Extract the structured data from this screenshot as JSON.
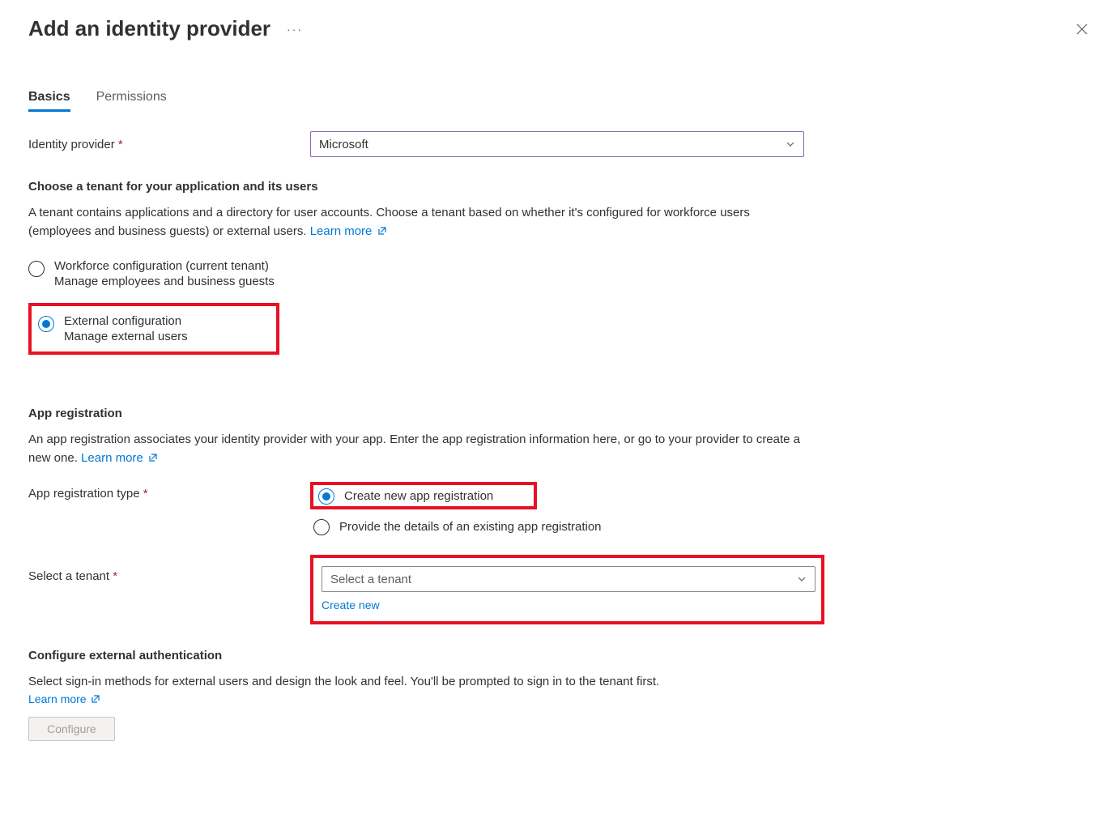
{
  "header": {
    "title": "Add an identity provider"
  },
  "tabs": {
    "basics": "Basics",
    "permissions": "Permissions"
  },
  "identityProvider": {
    "label": "Identity provider",
    "value": "Microsoft"
  },
  "tenantSection": {
    "title": "Choose a tenant for your application and its users",
    "description": "A tenant contains applications and a directory for user accounts. Choose a tenant based on whether it's configured for workforce users (employees and business guests) or external users. ",
    "learnMore": "Learn more",
    "workforce": {
      "label": "Workforce configuration (current tenant)",
      "sub": "Manage employees and business guests"
    },
    "external": {
      "label": "External configuration",
      "sub": "Manage external users"
    }
  },
  "appRegistration": {
    "title": "App registration",
    "description": "An app registration associates your identity provider with your app. Enter the app registration information here, or go to your provider to create a new one. ",
    "learnMore": "Learn more",
    "typeLabel": "App registration type",
    "createNew": "Create new app registration",
    "existing": "Provide the details of an existing app registration",
    "selectTenantLabel": "Select a tenant",
    "selectTenantPlaceholder": "Select a tenant",
    "createNewLink": "Create new"
  },
  "configureExternal": {
    "title": "Configure external authentication",
    "description": "Select sign-in methods for external users and design the look and feel. You'll be prompted to sign in to the tenant first.",
    "learnMore": "Learn more",
    "button": "Configure"
  }
}
